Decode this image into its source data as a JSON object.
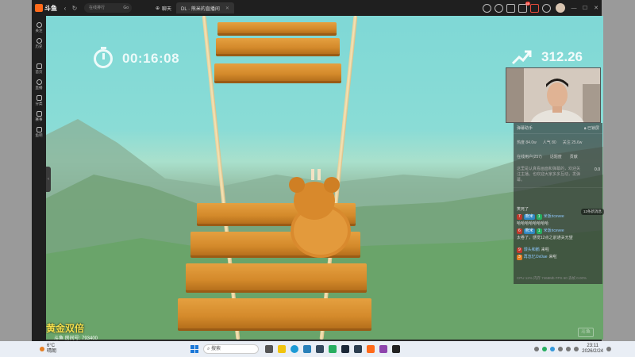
{
  "topbar": {
    "logo_text": "斗鱼",
    "search_placeholder": "在线排行",
    "search_go": "Go",
    "tabs": [
      {
        "label": "聊天",
        "icon": "plus-circle-icon"
      },
      {
        "label": "DL · 熊米的直播间",
        "active": true
      }
    ],
    "notification_count": "65"
  },
  "sidebar": {
    "items": [
      {
        "label": "关注"
      },
      {
        "label": "历史"
      },
      {
        "label": "首页"
      },
      {
        "label": "直播"
      },
      {
        "label": "分类"
      },
      {
        "label": "赛事"
      },
      {
        "label": "鱼吧"
      }
    ]
  },
  "video": {
    "timer": "00:16:08",
    "score": "312.26",
    "gold_text": "黄金双倍",
    "room_id": "斗鱼 房间号: 793400",
    "watermark": "斗鱼"
  },
  "panel": {
    "title": "弹幕助手",
    "status": "已锁屏",
    "stats": [
      "热度 84.0w",
      "人气 80",
      "关注 25.6w"
    ],
    "sub": [
      "在线用户(257)",
      "话题度",
      "贡献"
    ],
    "notice": "这里是认真看画面和弹幕的，欢迎关注主播。也欢迎大家多多互动，发弹幕。",
    "notice_count": "0.0",
    "pill": "12条新消息",
    "messages": [
      {
        "text": "笑死了",
        "level": "",
        "fan": "",
        "user": ""
      },
      {
        "level": "7",
        "fan": "熊米",
        "fan2": "1",
        "user": "米饭ricevee",
        "text": ""
      },
      {
        "text": "哈哈哈哈哈哈哈哈",
        "level": "",
        "fan": "",
        "user": ""
      },
      {
        "level": "6",
        "fan": "熊米",
        "fan2": "1",
        "user": "米饭ricevee",
        "text": ""
      },
      {
        "text": "太卷了，感觉12点之前通关无望",
        "level": "",
        "fan": "",
        "user": ""
      },
      {
        "level": "9",
        "fan": "",
        "user": "馒头和鹅",
        "text": "来啦"
      },
      {
        "level": "3",
        "fan": "",
        "user": "再忽忆Ox0ae",
        "text": "来啦"
      }
    ],
    "footer": "CPU 12%  内存 7468Mb  FPS 60  丢帧 0.00%"
  },
  "taskbar": {
    "temp": "6°C",
    "weather": "晴朗",
    "search": "搜索",
    "time": "23:11",
    "date": "2026/2/24"
  }
}
